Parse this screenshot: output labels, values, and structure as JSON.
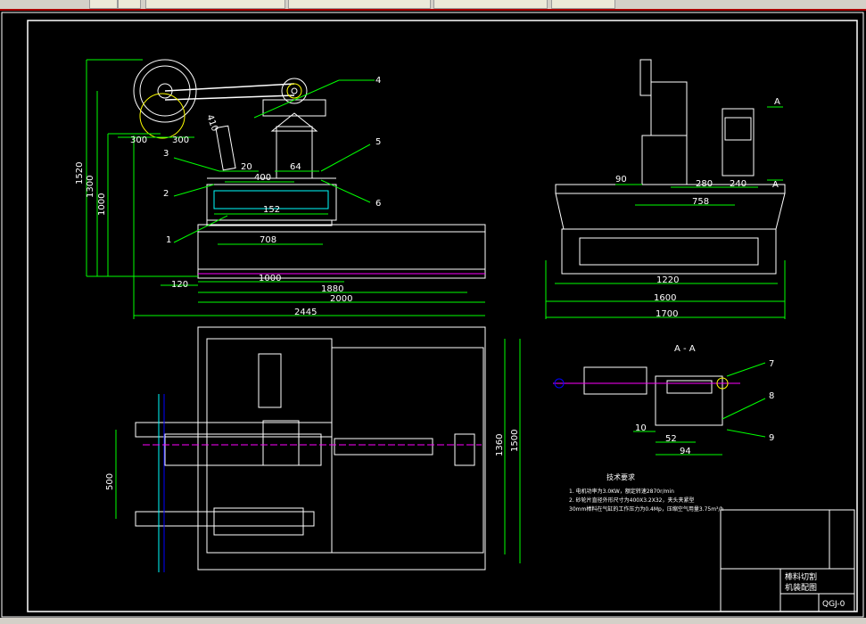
{
  "toolbar": {
    "buttons": [
      "",
      "",
      "",
      "",
      "",
      ""
    ]
  },
  "front_view": {
    "dims": [
      "1520",
      "1300",
      "1000",
      "300",
      "300",
      "20",
      "64",
      "400",
      "152",
      "708",
      "120",
      "1000",
      "1880",
      "2000",
      "2445",
      "410"
    ],
    "callouts": [
      "1",
      "2",
      "3",
      "4",
      "5",
      "6"
    ]
  },
  "side_view": {
    "dims": [
      "90",
      "280",
      "240",
      "758",
      "1220",
      "1600",
      "1700"
    ],
    "section_marks": [
      "A",
      "A"
    ]
  },
  "plan_view": {
    "dims": [
      "500",
      "1360",
      "1500"
    ]
  },
  "section_view": {
    "title": "A - A",
    "dims": [
      "10",
      "52",
      "94"
    ],
    "callouts": [
      "7",
      "8",
      "9"
    ]
  },
  "notes": {
    "heading": "技术要求",
    "lines": [
      "1. 电机功率为3.0KW，额定转速2870r/min",
      "2. 砂轮片直径外形尺寸为400X3.2X32，夹头夹紧型",
      "30mm棒料在气缸的工作压力为0.4Mp，压缩空气用量3.75m³/h"
    ]
  },
  "title_block": {
    "name_line1": "棒料切割",
    "name_line2": "机装配图",
    "drawing_no": "QGJ-0"
  }
}
